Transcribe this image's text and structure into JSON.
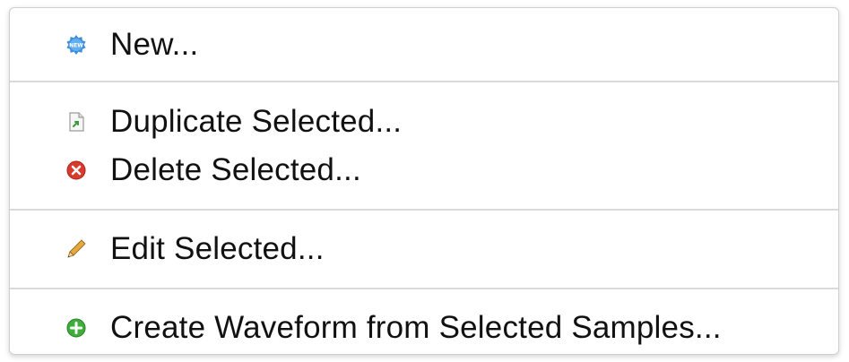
{
  "menu": {
    "items": [
      {
        "label": "New...",
        "icon": "new-badge-icon"
      },
      {
        "label": "Duplicate Selected...",
        "icon": "duplicate-document-icon"
      },
      {
        "label": "Delete Selected...",
        "icon": "delete-circle-icon"
      },
      {
        "label": "Edit Selected...",
        "icon": "pencil-icon"
      },
      {
        "label": "Create Waveform from Selected Samples...",
        "icon": "add-circle-icon"
      }
    ]
  },
  "colors": {
    "new_badge": "#3f8fd8",
    "delete": "#d93a2b",
    "add": "#3fae3a",
    "pencil": "#d9a23a",
    "separator": "#dadada"
  }
}
